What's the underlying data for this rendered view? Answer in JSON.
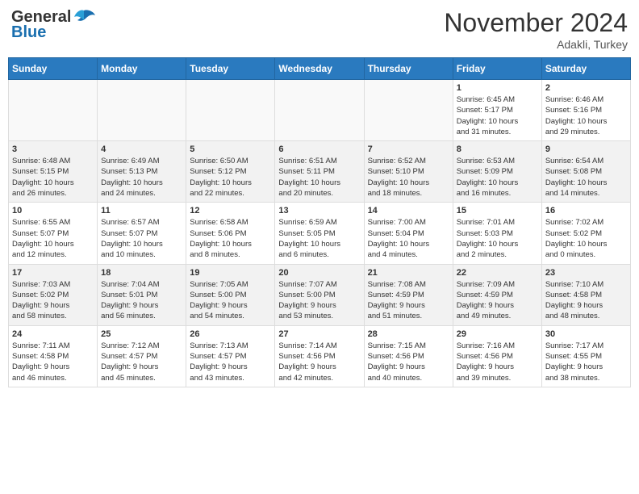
{
  "header": {
    "logo_general": "General",
    "logo_blue": "Blue",
    "month_title": "November 2024",
    "location": "Adakli, Turkey"
  },
  "weekdays": [
    "Sunday",
    "Monday",
    "Tuesday",
    "Wednesday",
    "Thursday",
    "Friday",
    "Saturday"
  ],
  "weeks": [
    [
      {
        "day": "",
        "info": ""
      },
      {
        "day": "",
        "info": ""
      },
      {
        "day": "",
        "info": ""
      },
      {
        "day": "",
        "info": ""
      },
      {
        "day": "",
        "info": ""
      },
      {
        "day": "1",
        "info": "Sunrise: 6:45 AM\nSunset: 5:17 PM\nDaylight: 10 hours\nand 31 minutes."
      },
      {
        "day": "2",
        "info": "Sunrise: 6:46 AM\nSunset: 5:16 PM\nDaylight: 10 hours\nand 29 minutes."
      }
    ],
    [
      {
        "day": "3",
        "info": "Sunrise: 6:48 AM\nSunset: 5:15 PM\nDaylight: 10 hours\nand 26 minutes."
      },
      {
        "day": "4",
        "info": "Sunrise: 6:49 AM\nSunset: 5:13 PM\nDaylight: 10 hours\nand 24 minutes."
      },
      {
        "day": "5",
        "info": "Sunrise: 6:50 AM\nSunset: 5:12 PM\nDaylight: 10 hours\nand 22 minutes."
      },
      {
        "day": "6",
        "info": "Sunrise: 6:51 AM\nSunset: 5:11 PM\nDaylight: 10 hours\nand 20 minutes."
      },
      {
        "day": "7",
        "info": "Sunrise: 6:52 AM\nSunset: 5:10 PM\nDaylight: 10 hours\nand 18 minutes."
      },
      {
        "day": "8",
        "info": "Sunrise: 6:53 AM\nSunset: 5:09 PM\nDaylight: 10 hours\nand 16 minutes."
      },
      {
        "day": "9",
        "info": "Sunrise: 6:54 AM\nSunset: 5:08 PM\nDaylight: 10 hours\nand 14 minutes."
      }
    ],
    [
      {
        "day": "10",
        "info": "Sunrise: 6:55 AM\nSunset: 5:07 PM\nDaylight: 10 hours\nand 12 minutes."
      },
      {
        "day": "11",
        "info": "Sunrise: 6:57 AM\nSunset: 5:07 PM\nDaylight: 10 hours\nand 10 minutes."
      },
      {
        "day": "12",
        "info": "Sunrise: 6:58 AM\nSunset: 5:06 PM\nDaylight: 10 hours\nand 8 minutes."
      },
      {
        "day": "13",
        "info": "Sunrise: 6:59 AM\nSunset: 5:05 PM\nDaylight: 10 hours\nand 6 minutes."
      },
      {
        "day": "14",
        "info": "Sunrise: 7:00 AM\nSunset: 5:04 PM\nDaylight: 10 hours\nand 4 minutes."
      },
      {
        "day": "15",
        "info": "Sunrise: 7:01 AM\nSunset: 5:03 PM\nDaylight: 10 hours\nand 2 minutes."
      },
      {
        "day": "16",
        "info": "Sunrise: 7:02 AM\nSunset: 5:02 PM\nDaylight: 10 hours\nand 0 minutes."
      }
    ],
    [
      {
        "day": "17",
        "info": "Sunrise: 7:03 AM\nSunset: 5:02 PM\nDaylight: 9 hours\nand 58 minutes."
      },
      {
        "day": "18",
        "info": "Sunrise: 7:04 AM\nSunset: 5:01 PM\nDaylight: 9 hours\nand 56 minutes."
      },
      {
        "day": "19",
        "info": "Sunrise: 7:05 AM\nSunset: 5:00 PM\nDaylight: 9 hours\nand 54 minutes."
      },
      {
        "day": "20",
        "info": "Sunrise: 7:07 AM\nSunset: 5:00 PM\nDaylight: 9 hours\nand 53 minutes."
      },
      {
        "day": "21",
        "info": "Sunrise: 7:08 AM\nSunset: 4:59 PM\nDaylight: 9 hours\nand 51 minutes."
      },
      {
        "day": "22",
        "info": "Sunrise: 7:09 AM\nSunset: 4:59 PM\nDaylight: 9 hours\nand 49 minutes."
      },
      {
        "day": "23",
        "info": "Sunrise: 7:10 AM\nSunset: 4:58 PM\nDaylight: 9 hours\nand 48 minutes."
      }
    ],
    [
      {
        "day": "24",
        "info": "Sunrise: 7:11 AM\nSunset: 4:58 PM\nDaylight: 9 hours\nand 46 minutes."
      },
      {
        "day": "25",
        "info": "Sunrise: 7:12 AM\nSunset: 4:57 PM\nDaylight: 9 hours\nand 45 minutes."
      },
      {
        "day": "26",
        "info": "Sunrise: 7:13 AM\nSunset: 4:57 PM\nDaylight: 9 hours\nand 43 minutes."
      },
      {
        "day": "27",
        "info": "Sunrise: 7:14 AM\nSunset: 4:56 PM\nDaylight: 9 hours\nand 42 minutes."
      },
      {
        "day": "28",
        "info": "Sunrise: 7:15 AM\nSunset: 4:56 PM\nDaylight: 9 hours\nand 40 minutes."
      },
      {
        "day": "29",
        "info": "Sunrise: 7:16 AM\nSunset: 4:56 PM\nDaylight: 9 hours\nand 39 minutes."
      },
      {
        "day": "30",
        "info": "Sunrise: 7:17 AM\nSunset: 4:55 PM\nDaylight: 9 hours\nand 38 minutes."
      }
    ]
  ]
}
